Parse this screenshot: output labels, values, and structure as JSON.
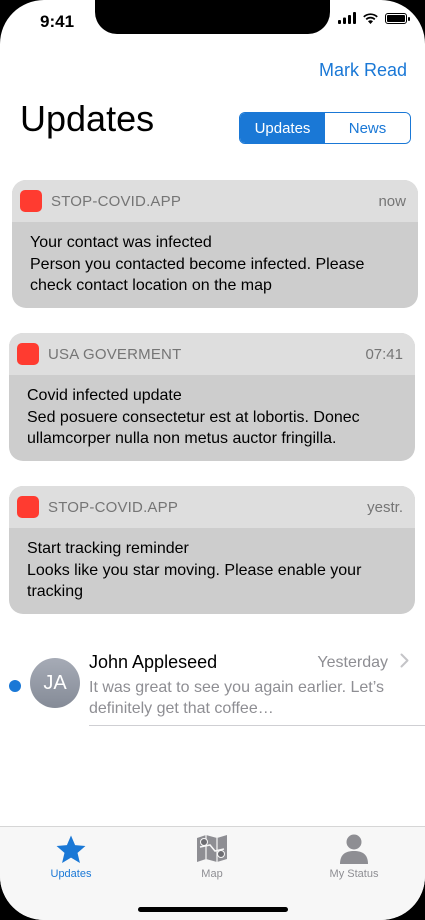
{
  "status_bar": {
    "time": "9:41"
  },
  "header": {
    "mark_read": "Mark Read",
    "title": "Updates",
    "segments": [
      "Updates",
      "News"
    ],
    "active_segment": "Updates"
  },
  "notifications": [
    {
      "app": "STOP-COVID.APP",
      "time": "now",
      "title": "Your contact was infected",
      "body": "Person you contacted become infected. Please check contact location on the map"
    },
    {
      "app": "USA GOVERMENT",
      "time": "07:41",
      "title": "Covid infected update",
      "body": "Sed posuere consectetur est at lobortis. Donec ullamcorper nulla non metus auctor fringilla."
    },
    {
      "app": "STOP-COVID.APP",
      "time": "yestr.",
      "title": "Start tracking reminder",
      "body": "Looks like you star moving. Please enable your tracking"
    }
  ],
  "message": {
    "initials": "JA",
    "sender": "John Appleseed",
    "time": "Yesterday",
    "preview": "It was great to see you again earlier. Let’s definitely get that coffee…",
    "unread": true
  },
  "tabbar": {
    "tabs": [
      {
        "label": "Updates",
        "icon": "star-icon",
        "active": true
      },
      {
        "label": "Map",
        "icon": "map-icon",
        "active": false
      },
      {
        "label": "My Status",
        "icon": "person-icon",
        "active": false
      }
    ]
  },
  "colors": {
    "accent": "#1a78d6",
    "app_icon": "#ff3b30"
  }
}
